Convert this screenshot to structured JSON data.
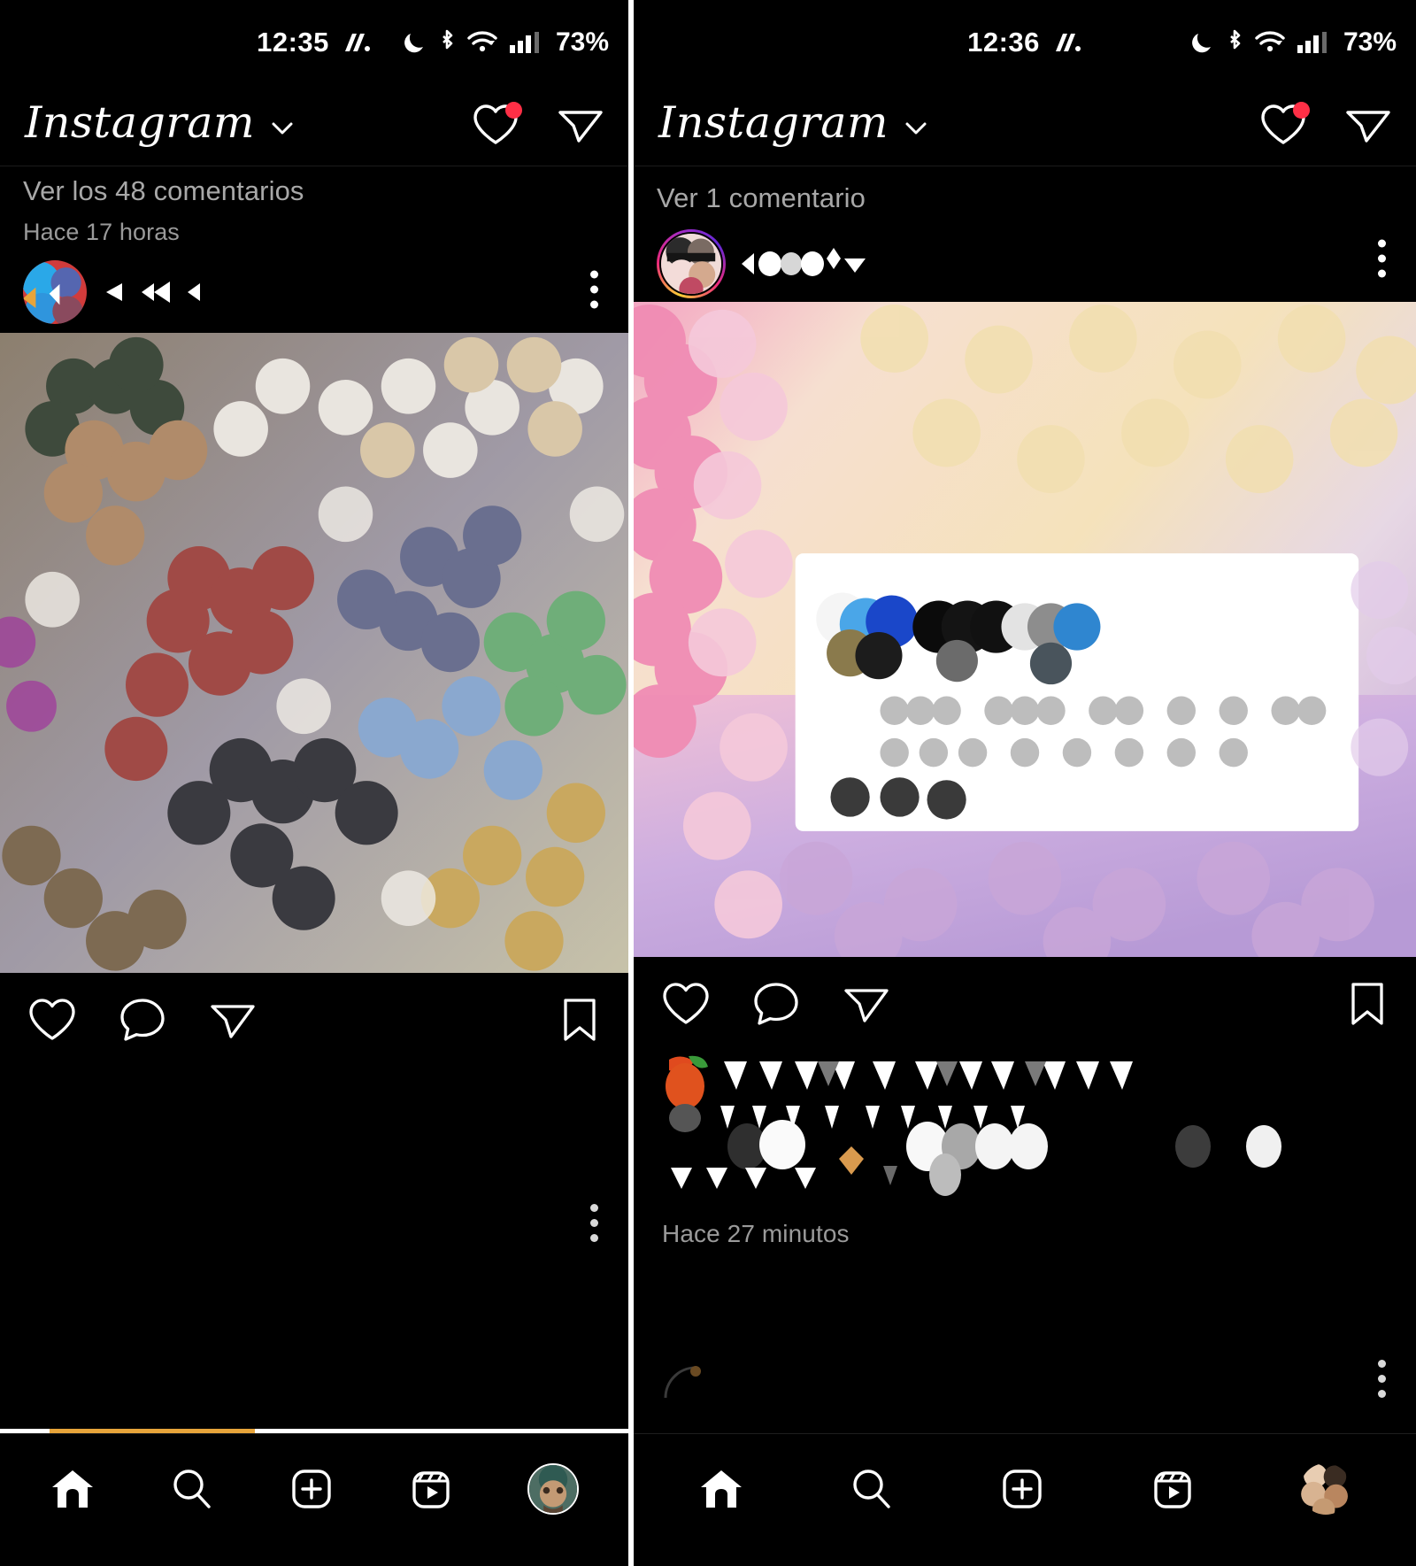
{
  "meta": {
    "app_name": "Instagram",
    "language": "es",
    "accent_red": "#ff2f46",
    "background": "#000000",
    "text_muted": "#a8a8a8",
    "story_ring_colors": [
      "#f9ce34",
      "#ee2a7b",
      "#a02bc5",
      "#6228d7"
    ]
  },
  "left": {
    "status_bar": {
      "time": "12:35",
      "carrier_icon": "nothing-glyph-icon",
      "battery_percent": "73%",
      "icons": [
        "dnd-moon-icon",
        "bluetooth-icon",
        "wifi-icon",
        "cellular-signal-icon"
      ]
    },
    "header": {
      "logo_text": "Instagram",
      "dropdown_icon": "chevron-down-icon",
      "notifications_icon": "heart-icon",
      "notifications_badge": true,
      "messages_icon": "direct-share-icon"
    },
    "previous_post": {
      "comments_link": "Ver los 48 comentarios",
      "timestamp": "Hace 17 horas"
    },
    "post": {
      "avatar": "pixelated-profile-photo",
      "username": "redacted-username",
      "options_icon": "kebab-menu-icon",
      "media": "pixelated-photo",
      "actions": {
        "like_icon": "heart-icon",
        "comment_icon": "comment-bubble-icon",
        "share_icon": "direct-share-icon",
        "save_icon": "bookmark-icon"
      }
    },
    "loader": {
      "progress_percent": 33
    },
    "bottom_nav": {
      "items": [
        {
          "icon": "home-icon",
          "label": "Inicio",
          "active": true
        },
        {
          "icon": "search-icon",
          "label": "Buscar",
          "active": false
        },
        {
          "icon": "create-plus-icon",
          "label": "Crear",
          "active": false
        },
        {
          "icon": "reels-icon",
          "label": "Reels",
          "active": false
        },
        {
          "icon": "profile-avatar",
          "label": "Perfil",
          "active": false
        }
      ]
    }
  },
  "right": {
    "status_bar": {
      "time": "12:36",
      "carrier_icon": "nothing-glyph-icon",
      "battery_percent": "73%",
      "icons": [
        "dnd-moon-icon",
        "bluetooth-icon",
        "wifi-icon",
        "cellular-signal-icon"
      ]
    },
    "header": {
      "logo_text": "Instagram",
      "dropdown_icon": "chevron-down-icon",
      "notifications_icon": "heart-icon",
      "notifications_badge": true,
      "messages_icon": "direct-share-icon"
    },
    "previous_post": {
      "comments_link": "Ver 1 comentario"
    },
    "post": {
      "avatar": "pixelated-profile-photo-with-story-ring",
      "username": "redacted-username",
      "options_icon": "kebab-menu-icon",
      "media": "pixelated-photo",
      "caption": "redacted-caption-text",
      "timestamp": "Hace 27 minutos",
      "actions": {
        "like_icon": "heart-icon",
        "comment_icon": "comment-bubble-icon",
        "share_icon": "direct-share-icon",
        "save_icon": "bookmark-icon"
      }
    },
    "bottom_nav": {
      "items": [
        {
          "icon": "home-icon",
          "label": "Inicio",
          "active": true
        },
        {
          "icon": "search-icon",
          "label": "Buscar",
          "active": false
        },
        {
          "icon": "create-plus-icon",
          "label": "Crear",
          "active": false
        },
        {
          "icon": "reels-icon",
          "label": "Reels",
          "active": false
        },
        {
          "icon": "profile-avatar",
          "label": "Perfil",
          "active": false
        }
      ]
    }
  }
}
